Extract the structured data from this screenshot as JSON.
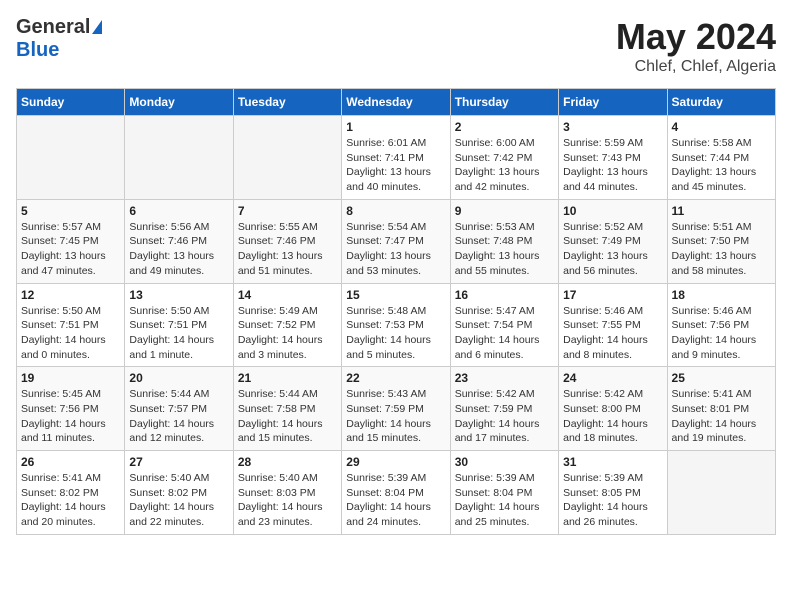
{
  "header": {
    "logo_general": "General",
    "logo_blue": "Blue",
    "month_year": "May 2024",
    "location": "Chlef, Chlef, Algeria"
  },
  "weekdays": [
    "Sunday",
    "Monday",
    "Tuesday",
    "Wednesday",
    "Thursday",
    "Friday",
    "Saturday"
  ],
  "weeks": [
    [
      {
        "day": "",
        "info": ""
      },
      {
        "day": "",
        "info": ""
      },
      {
        "day": "",
        "info": ""
      },
      {
        "day": "1",
        "info": "Sunrise: 6:01 AM\nSunset: 7:41 PM\nDaylight: 13 hours\nand 40 minutes."
      },
      {
        "day": "2",
        "info": "Sunrise: 6:00 AM\nSunset: 7:42 PM\nDaylight: 13 hours\nand 42 minutes."
      },
      {
        "day": "3",
        "info": "Sunrise: 5:59 AM\nSunset: 7:43 PM\nDaylight: 13 hours\nand 44 minutes."
      },
      {
        "day": "4",
        "info": "Sunrise: 5:58 AM\nSunset: 7:44 PM\nDaylight: 13 hours\nand 45 minutes."
      }
    ],
    [
      {
        "day": "5",
        "info": "Sunrise: 5:57 AM\nSunset: 7:45 PM\nDaylight: 13 hours\nand 47 minutes."
      },
      {
        "day": "6",
        "info": "Sunrise: 5:56 AM\nSunset: 7:46 PM\nDaylight: 13 hours\nand 49 minutes."
      },
      {
        "day": "7",
        "info": "Sunrise: 5:55 AM\nSunset: 7:46 PM\nDaylight: 13 hours\nand 51 minutes."
      },
      {
        "day": "8",
        "info": "Sunrise: 5:54 AM\nSunset: 7:47 PM\nDaylight: 13 hours\nand 53 minutes."
      },
      {
        "day": "9",
        "info": "Sunrise: 5:53 AM\nSunset: 7:48 PM\nDaylight: 13 hours\nand 55 minutes."
      },
      {
        "day": "10",
        "info": "Sunrise: 5:52 AM\nSunset: 7:49 PM\nDaylight: 13 hours\nand 56 minutes."
      },
      {
        "day": "11",
        "info": "Sunrise: 5:51 AM\nSunset: 7:50 PM\nDaylight: 13 hours\nand 58 minutes."
      }
    ],
    [
      {
        "day": "12",
        "info": "Sunrise: 5:50 AM\nSunset: 7:51 PM\nDaylight: 14 hours\nand 0 minutes."
      },
      {
        "day": "13",
        "info": "Sunrise: 5:50 AM\nSunset: 7:51 PM\nDaylight: 14 hours\nand 1 minute."
      },
      {
        "day": "14",
        "info": "Sunrise: 5:49 AM\nSunset: 7:52 PM\nDaylight: 14 hours\nand 3 minutes."
      },
      {
        "day": "15",
        "info": "Sunrise: 5:48 AM\nSunset: 7:53 PM\nDaylight: 14 hours\nand 5 minutes."
      },
      {
        "day": "16",
        "info": "Sunrise: 5:47 AM\nSunset: 7:54 PM\nDaylight: 14 hours\nand 6 minutes."
      },
      {
        "day": "17",
        "info": "Sunrise: 5:46 AM\nSunset: 7:55 PM\nDaylight: 14 hours\nand 8 minutes."
      },
      {
        "day": "18",
        "info": "Sunrise: 5:46 AM\nSunset: 7:56 PM\nDaylight: 14 hours\nand 9 minutes."
      }
    ],
    [
      {
        "day": "19",
        "info": "Sunrise: 5:45 AM\nSunset: 7:56 PM\nDaylight: 14 hours\nand 11 minutes."
      },
      {
        "day": "20",
        "info": "Sunrise: 5:44 AM\nSunset: 7:57 PM\nDaylight: 14 hours\nand 12 minutes."
      },
      {
        "day": "21",
        "info": "Sunrise: 5:44 AM\nSunset: 7:58 PM\nDaylight: 14 hours\nand 15 minutes."
      },
      {
        "day": "22",
        "info": "Sunrise: 5:43 AM\nSunset: 7:59 PM\nDaylight: 14 hours\nand 15 minutes."
      },
      {
        "day": "23",
        "info": "Sunrise: 5:42 AM\nSunset: 7:59 PM\nDaylight: 14 hours\nand 17 minutes."
      },
      {
        "day": "24",
        "info": "Sunrise: 5:42 AM\nSunset: 8:00 PM\nDaylight: 14 hours\nand 18 minutes."
      },
      {
        "day": "25",
        "info": "Sunrise: 5:41 AM\nSunset: 8:01 PM\nDaylight: 14 hours\nand 19 minutes."
      }
    ],
    [
      {
        "day": "26",
        "info": "Sunrise: 5:41 AM\nSunset: 8:02 PM\nDaylight: 14 hours\nand 20 minutes."
      },
      {
        "day": "27",
        "info": "Sunrise: 5:40 AM\nSunset: 8:02 PM\nDaylight: 14 hours\nand 22 minutes."
      },
      {
        "day": "28",
        "info": "Sunrise: 5:40 AM\nSunset: 8:03 PM\nDaylight: 14 hours\nand 23 minutes."
      },
      {
        "day": "29",
        "info": "Sunrise: 5:39 AM\nSunset: 8:04 PM\nDaylight: 14 hours\nand 24 minutes."
      },
      {
        "day": "30",
        "info": "Sunrise: 5:39 AM\nSunset: 8:04 PM\nDaylight: 14 hours\nand 25 minutes."
      },
      {
        "day": "31",
        "info": "Sunrise: 5:39 AM\nSunset: 8:05 PM\nDaylight: 14 hours\nand 26 minutes."
      },
      {
        "day": "",
        "info": ""
      }
    ]
  ]
}
